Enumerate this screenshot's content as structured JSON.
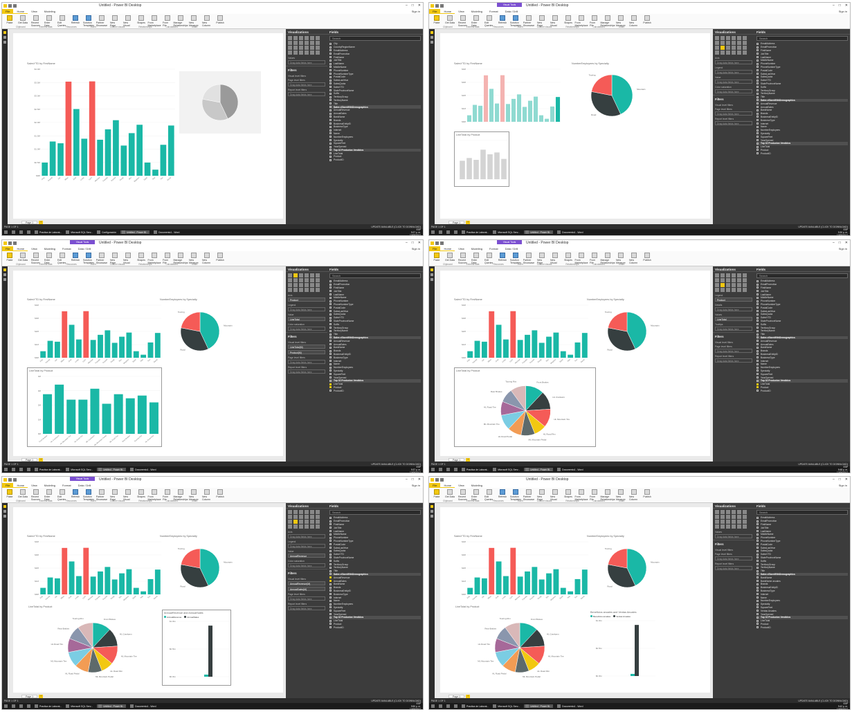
{
  "window": {
    "title": "Untitled - Power BI Desktop",
    "context_tab": "Visual Tools",
    "sign_in": "Sign in"
  },
  "ribbon": {
    "tabs": [
      "File",
      "Home",
      "View",
      "Modeling",
      "Format",
      "Data / Drill"
    ],
    "buttons": [
      "Paste",
      "Get Data",
      "Recent Sources",
      "Enter Data",
      "Edit Queries",
      "Refresh",
      "Solution Templates",
      "Partner Showcase",
      "New Page",
      "New Visual",
      "Shapes",
      "From Marketplace",
      "From File",
      "Manage Relationships",
      "New Measure",
      "New Column",
      "Publish"
    ],
    "small": [
      "Cut",
      "Copy",
      "Format Painter",
      "Text box",
      "Image",
      "New Measure",
      "New Column"
    ],
    "groups": [
      "Clipboard",
      "External data",
      "Resources",
      "Insert",
      "Custom visuals",
      "Relationships",
      "Calculations",
      "Share"
    ]
  },
  "panels": {
    "visualizations": "Visualizations",
    "fields": "Fields",
    "filters": "Filters",
    "search_placeholder": "Search",
    "axis": "Axis",
    "legend": "Legend",
    "value": "Value",
    "values": "Values",
    "details": "Details",
    "tooltips": "Tooltips",
    "color_saturation": "Color saturation",
    "drag_here": "Drag data fields here",
    "visual_filters": "Visual level filters",
    "page_filters": "Page level filters",
    "report_filters": "Report level filters"
  },
  "fields": {
    "customer_fields": [
      "City",
      "CountryRegionName",
      "EmailAddress",
      "EmailPromotion",
      "FirstName",
      "JobTitle",
      "LastName",
      "MiddleName",
      "PhoneNumber",
      "PhoneNumberType",
      "PostalCode",
      "SalesLastYear",
      "SalesQuota",
      "SalesYTD",
      "StateProvinceName",
      "Suffix",
      "TerritoryGroup",
      "TerritoryName",
      "Title"
    ],
    "table_demographics": "Sales vStoreWithDemographics",
    "demo_fields": [
      "AnnualRevenue",
      "AnnualSales",
      "BankName",
      "Brands",
      "BusinessEntityID",
      "BusinessType",
      "Internet",
      "Name",
      "NumberEmployees",
      "Specialty",
      "SquareFeet",
      "YearOpened"
    ],
    "demo_fields_es": [
      "BankName",
      "BankName anuales",
      "Brands",
      "BusinessEntityID",
      "BusinessType",
      "Internet",
      "Name",
      "NumberEmployees",
      "Specialty",
      "SquareFeet",
      "Ventas Anuales",
      "YearOpened"
    ],
    "table_top10": "Top 10 Productos Vendidos",
    "top10_fields": [
      "LineTotal",
      "Product",
      "ProductID"
    ]
  },
  "well_values": {
    "product": "Product",
    "line_total": "LineTotal",
    "line_total_m": "LineTotal(M)",
    "product_m": "Product(M)",
    "annual_revenue": "AnnualRevenue",
    "annual_sales": "AnnualSales",
    "annual_revenue_m": "AnnualRevenue(M)",
    "annual_sales_m": "AnnualSales(M)"
  },
  "page": {
    "tab": "Page 1",
    "add": "+",
    "status_left": "PAGE 1 OF 1",
    "status_right": "UPDATE AVAILABLE (CLICK TO DOWNLOAD)"
  },
  "taskbar": {
    "apps": [
      "Practica de Laborat...",
      "Microsoft SQL Serv...",
      "Configuración",
      "Untitled - Power BI...",
      "Documento1 - Word"
    ],
    "lang": "ESP",
    "times": [
      "9:27 p. m.",
      "9:30 p. m.",
      "9:37 p. m.",
      "9:48 p. m.",
      "9:50 p. m.",
      "9:42 p. m."
    ],
    "date": "10/06/2017"
  },
  "visual_titles": {
    "sales_by_name": "SalesYTD by FirstName",
    "emp_by_specialty": "NumberEmployees by Specialty",
    "line_by_product": "LineTotal by Product",
    "rev_sales": "AnnualRevenue and AnnualSales",
    "rev_sales_es": "Beneficios anuales and Ventas Anuales"
  },
  "legend_labels": {
    "rev": "AnnualRevenue",
    "sales": "AnnualSales",
    "rev_es": "Beneficios anuales",
    "sales_es": "Ventas Anuales"
  },
  "colors": {
    "teal": "#1ab8a6",
    "coral": "#f55b57",
    "dark": "#363f40",
    "yellow": "#f2c811",
    "light_coral": "#f4b3b1",
    "light_teal": "#8fdad1",
    "grey": "#bfbfbf"
  },
  "chart_data": [
    {
      "type": "bar",
      "title": "SalesYTD by FirstName",
      "ylabel": "",
      "xlabel": "",
      "y_ticks": [
        "$0M",
        "$0.5M",
        "$1.0M",
        "$1.5M",
        "$2.0M",
        "$2.5M",
        "$3.0M",
        "$3.5M",
        "$4.0M"
      ],
      "y_ticks_short": [
        "$0M",
        "$1M",
        "$2M",
        "$3M",
        "$4M"
      ],
      "ylim": [
        0,
        4.2
      ],
      "categories": [
        "Amy",
        "Garrett",
        "Jae",
        "Jillian",
        "José",
        "Linda",
        "Lynn",
        "Michael",
        "Pamela",
        "Rachel",
        "Ranjit",
        "Shu",
        "Stephen",
        "Syed",
        "Tete",
        "Tsvi",
        "David"
      ],
      "values": [
        0.52,
        1.35,
        1.28,
        3.71,
        2.63,
        1.46,
        3.72,
        1.42,
        1.83,
        2.19,
        1.19,
        1.68,
        2.01,
        0.52,
        0.24,
        1.22,
        1.98
      ],
      "highlight_colors": [
        "teal",
        "teal",
        "teal",
        "coral",
        "teal",
        "teal",
        "coral",
        "teal",
        "teal",
        "teal",
        "teal",
        "teal",
        "teal",
        "teal",
        "teal",
        "teal",
        "teal"
      ]
    },
    {
      "type": "pie",
      "title": "NumberEmployees by Specialty",
      "categories": [
        "Mountain",
        "Road",
        "Touring"
      ],
      "values": [
        43,
        35,
        22
      ],
      "colors": [
        "teal",
        "dark",
        "coral"
      ]
    },
    {
      "type": "bar",
      "title": "LineTotal by Product",
      "y_ticks": [
        "0M",
        "1M",
        "2M",
        "3M",
        "4M"
      ],
      "ylim": [
        0,
        4.2
      ],
      "categories": [
        "Front Brakes",
        "HL Crankarm",
        "HL Mountain Tire",
        "HL Road Tire",
        "ML Crankarm",
        "ML Mountain Pedal",
        "ML Road Tire",
        "Rear Brakes",
        "Touring Rim",
        "HL Road Rim"
      ],
      "values": [
        2.9,
        3.6,
        2.5,
        2.5,
        3.3,
        2.2,
        2.9,
        2.6,
        2.8,
        2.3
      ]
    },
    {
      "type": "pie",
      "title": "LineTotal by Product",
      "categories": [
        "Front Brakes",
        "HL Crankarm",
        "HL Mountain Tire",
        "HL Road Rim",
        "ML Mountain Pedal",
        "HL Road Pedal",
        "ML Mountain Tire",
        "HL Road Tire",
        "Rear Brakes",
        "Touring Rim"
      ],
      "values": [
        12,
        12,
        12,
        8,
        9,
        9,
        10,
        9,
        9,
        10
      ],
      "colors": [
        "#1ab8a6",
        "#363f40",
        "#f55b57",
        "#f2c811",
        "#5e6a6b",
        "#f29c54",
        "#7bcde3",
        "#a66999",
        "#8a96ad",
        "#d9b8b8"
      ]
    },
    {
      "type": "bar",
      "title": "AnnualRevenue and AnnualSales",
      "categories": [
        "AnnualRevenue",
        "AnnualSales"
      ],
      "series": [
        {
          "name": "AnnualRevenue",
          "values": [
            0.05
          ]
        },
        {
          "name": "AnnualSales",
          "values": [
            1.2
          ]
        }
      ],
      "y_ticks": [
        "$0.0bn",
        "$0.5bn",
        "$1.0bn"
      ],
      "ylim": [
        0,
        1.3
      ]
    }
  ]
}
